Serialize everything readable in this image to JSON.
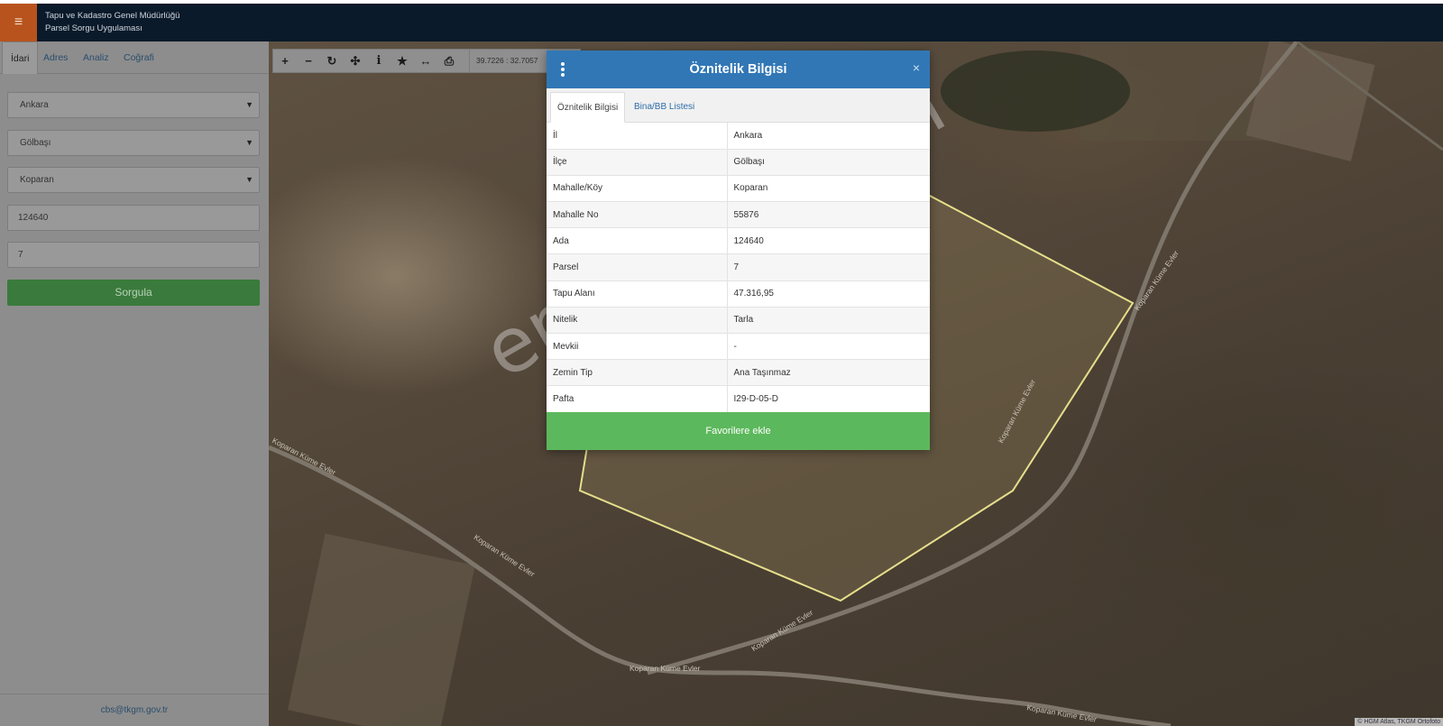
{
  "header": {
    "menu_icon": "≡",
    "org_name": "Tapu ve Kadastro Genel Müdürlüğü",
    "app_name": "Parsel Sorgu Uygulaması"
  },
  "sidebar": {
    "tabs": [
      "İdari",
      "Adres",
      "Analiz",
      "Coğrafi"
    ],
    "il": "Ankara",
    "ilce": "Gölbaşı",
    "mahalle": "Koparan",
    "ada": "124640",
    "parsel": "7",
    "submit_label": "Sorgula",
    "email": "cbs@tkgm.gov.tr"
  },
  "toolbar": {
    "coords": "39.7226 : 32.7057"
  },
  "map": {
    "road_labels": [
      "Koparan Küme Evler",
      "Koparan Küme Evler",
      "Koparan Küme Evler",
      "Koparan Küme Evler",
      "Koparan Küme Evler",
      "Koparan Küme Evler",
      "Koparan Küme Evler"
    ],
    "attribution": "© HGM Atlas, TKGM Ortofoto",
    "watermark": "emlakjet.com",
    "parcel_color": "#e6df8c"
  },
  "modal": {
    "title": "Öznitelik Bilgisi",
    "close_label": "×",
    "tabs": [
      "Öznitelik Bilgisi",
      "Bina/BB Listesi"
    ],
    "rows": [
      {
        "key": "İl",
        "value": "Ankara"
      },
      {
        "key": "İlçe",
        "value": "Gölbaşı"
      },
      {
        "key": "Mahalle/Köy",
        "value": "Koparan"
      },
      {
        "key": "Mahalle No",
        "value": "55876"
      },
      {
        "key": "Ada",
        "value": "124640"
      },
      {
        "key": "Parsel",
        "value": "7"
      },
      {
        "key": "Tapu Alanı",
        "value": "47.316,95"
      },
      {
        "key": "Nitelik",
        "value": "Tarla"
      },
      {
        "key": "Mevkii",
        "value": "-"
      },
      {
        "key": "Zemin Tip",
        "value": "Ana Taşınmaz"
      },
      {
        "key": "Pafta",
        "value": "I29-D-05-D"
      }
    ],
    "favorite_label": "Favorilere ekle"
  }
}
